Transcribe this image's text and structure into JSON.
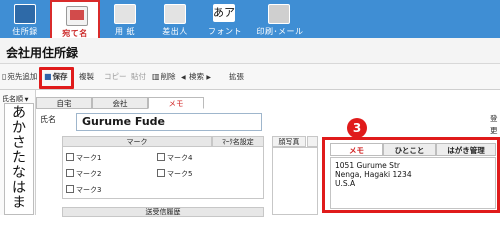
{
  "ribbon": {
    "tabs": [
      {
        "label": "住所録",
        "icon": "address-book-icon",
        "color": "#2e6aa8"
      },
      {
        "label": "宛て名",
        "icon": "envelope-icon",
        "color": "#d24b4b",
        "active": true
      },
      {
        "label": "用 紙",
        "icon": "paper-icon",
        "color": "#e3e3e3"
      },
      {
        "label": "差出人",
        "icon": "sender-icon",
        "color": "#e3e3e3"
      },
      {
        "label": "フォント",
        "icon": "font-icon",
        "glyph": "あア"
      },
      {
        "label": "印刷･メール",
        "icon": "printer-icon",
        "color": "#cfcfcf"
      }
    ]
  },
  "window": {
    "title": "会社用住所録"
  },
  "toolbar": {
    "add_label": "宛先追加",
    "save_label": "保存",
    "duplicate_label": "複製",
    "copy_label": "コピー",
    "paste_label": "貼付",
    "delete_label": "削除",
    "search_label": "検索",
    "expand_label": "拡張"
  },
  "left_panel": {
    "header": "氏名順",
    "kana": [
      "あ",
      "か",
      "さ",
      "た",
      "な",
      "は",
      "ま"
    ]
  },
  "record_tabs": [
    {
      "label": "自宅"
    },
    {
      "label": "会社"
    },
    {
      "label": "メモ",
      "active": true
    }
  ],
  "form": {
    "name_label": "氏名",
    "name_value": "Gurume Fude",
    "mark_header": "マーク",
    "markname_header": "ﾏｰｸ名設定",
    "marks": [
      "マーク1",
      "マーク2",
      "マーク3",
      "マーク4",
      "マーク5"
    ],
    "photo_label": "顔写真",
    "history_header": "送受信履歴"
  },
  "memo_panel": {
    "badge": "3",
    "tabs": [
      {
        "label": "メモ",
        "active": true
      },
      {
        "label": "ひとこと"
      },
      {
        "label": "はがき管理"
      }
    ],
    "text": "1051 Gurume Str\nNenga, Hagaki 1234\nU.S.A"
  },
  "edge_labels": [
    "登",
    "更"
  ]
}
